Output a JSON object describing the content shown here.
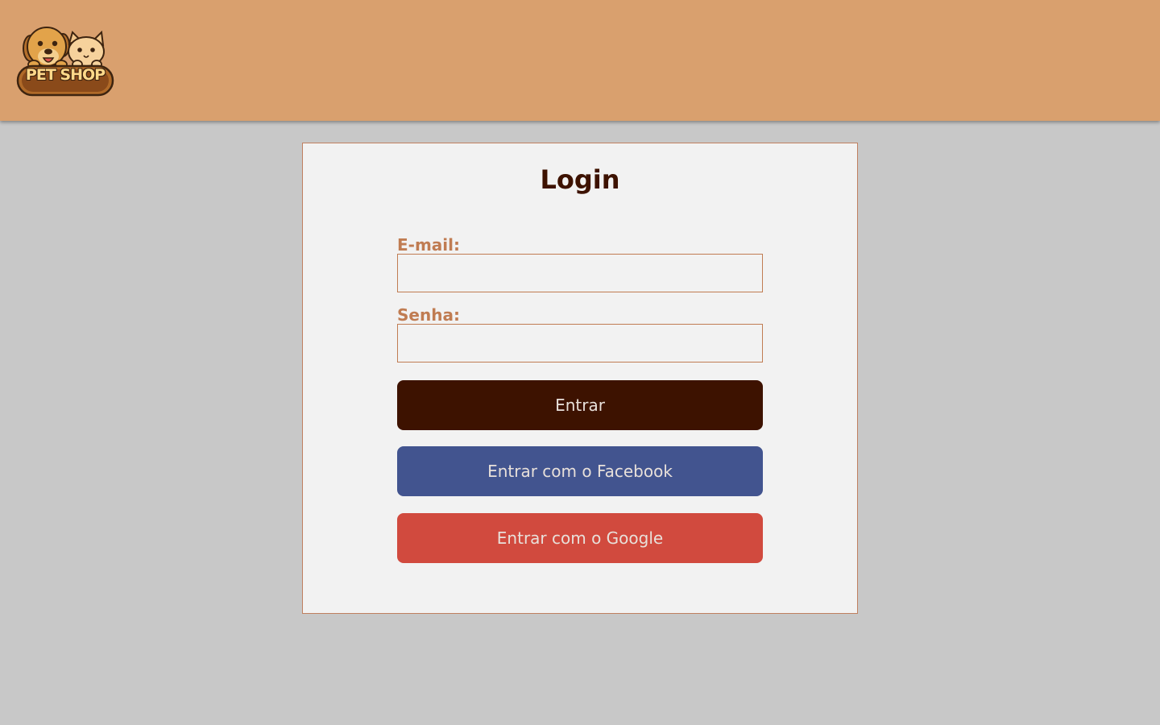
{
  "header": {
    "logo_text": "PET SHOP",
    "logo_icon": "dog-and-cat-icon",
    "background": "#d9a06e"
  },
  "login": {
    "title": "Login",
    "email_label": "E-mail:",
    "email_value": "",
    "email_placeholder": "",
    "password_label": "Senha:",
    "password_value": "",
    "password_placeholder": "",
    "submit_label": "Entrar",
    "facebook_label": "Entrar com o Facebook",
    "google_label": "Entrar com o Google"
  },
  "colors": {
    "submit": "#3d1200",
    "facebook": "#42548f",
    "google": "#d14a3e",
    "label": "#c07c52",
    "page_bg": "#c8c8c8",
    "card_bg": "#f2f2f2"
  }
}
